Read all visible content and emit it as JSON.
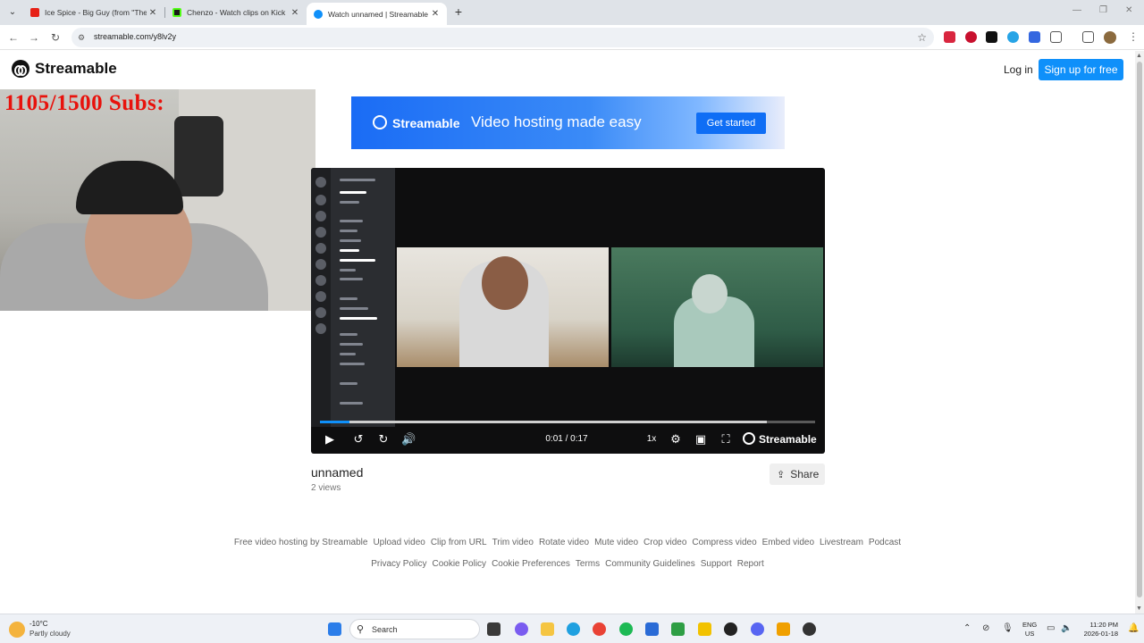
{
  "browser": {
    "tabs": [
      {
        "title": "Ice Spice - Big Guy (from \"The S",
        "color": "#e62117"
      },
      {
        "title": "Chenzo - Watch clips on Kick",
        "color": "#53fc18"
      },
      {
        "title": "Watch unnamed | Streamable",
        "color": "#0f90fa"
      }
    ],
    "url": "streamable.com/y8lv2y"
  },
  "site": {
    "logo": "Streamable",
    "login": "Log in",
    "signup": "Sign up for free"
  },
  "overlay": {
    "subs_text": "1105/1500  Subs:"
  },
  "ad": {
    "brand": "Streamable",
    "tagline": "Video hosting made easy",
    "cta": "Get started"
  },
  "video": {
    "time": "0:01 / 0:17",
    "speed": "1x",
    "brand": "Streamable",
    "progress_fraction": 0.06,
    "title": "unnamed",
    "views": "2 views",
    "share": "Share"
  },
  "footer": {
    "row1": [
      "Free video hosting by Streamable",
      "Upload video",
      "Clip from URL",
      "Trim video",
      "Rotate video",
      "Mute video",
      "Crop video",
      "Compress video",
      "Embed video",
      "Livestream",
      "Podcast"
    ],
    "row2": [
      "Privacy Policy",
      "Cookie Policy",
      "Cookie Preferences",
      "Terms",
      "Community Guidelines",
      "Support",
      "Report"
    ]
  },
  "taskbar": {
    "temp": "-10°C",
    "condition": "Partly cloudy",
    "search": "Search",
    "lang1": "ENG",
    "lang2": "US",
    "time": "11:20 PM",
    "date": "2026-01-18"
  }
}
